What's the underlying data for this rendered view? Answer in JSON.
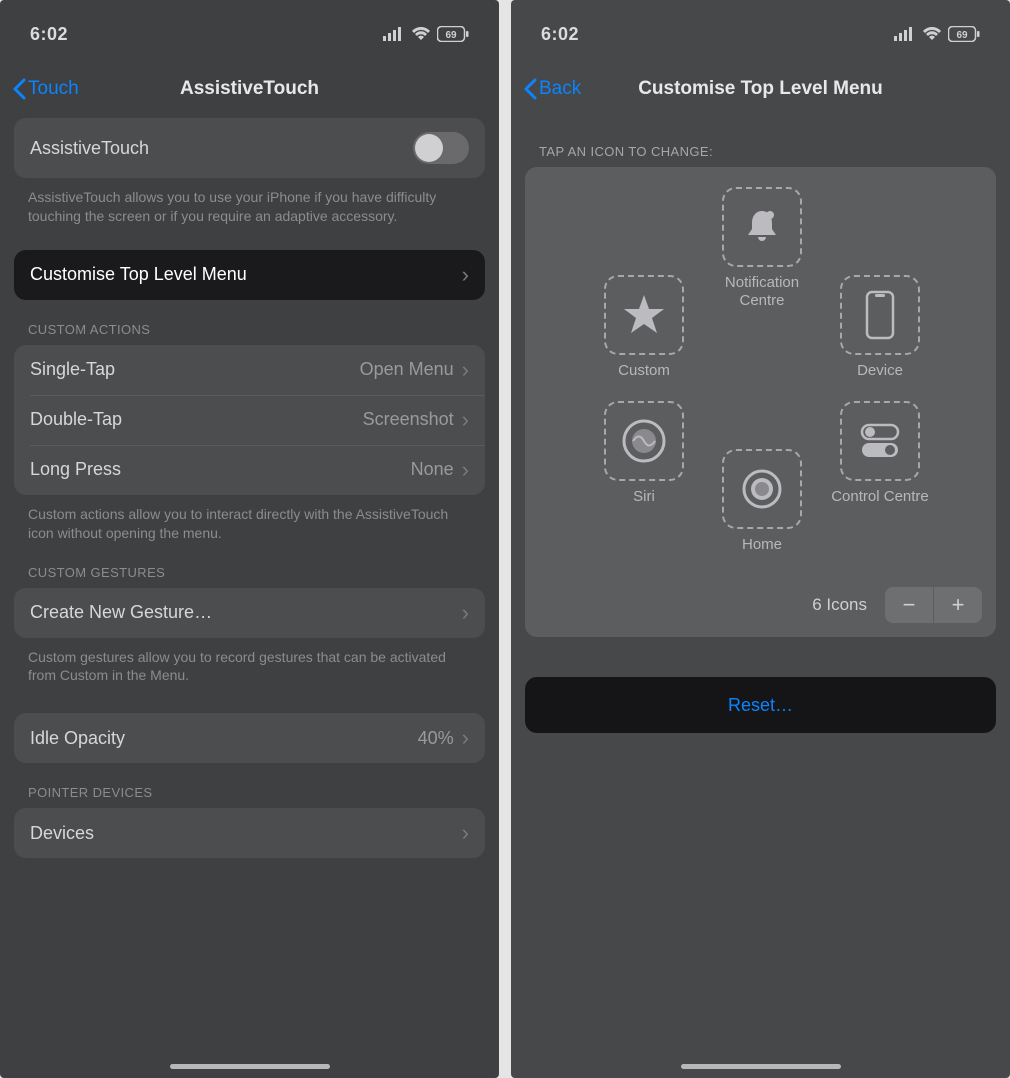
{
  "status": {
    "time": "6:02",
    "battery": "69"
  },
  "left": {
    "back": "Touch",
    "title": "AssistiveTouch",
    "toggle_label": "AssistiveTouch",
    "toggle_desc": "AssistiveTouch allows you to use your iPhone if you have difficulty touching the screen or if you require an adaptive accessory.",
    "customise": "Customise Top Level Menu",
    "custom_actions_header": "CUSTOM ACTIONS",
    "actions": {
      "single_tap": {
        "label": "Single-Tap",
        "value": "Open Menu"
      },
      "double_tap": {
        "label": "Double-Tap",
        "value": "Screenshot"
      },
      "long_press": {
        "label": "Long Press",
        "value": "None"
      }
    },
    "actions_desc": "Custom actions allow you to interact directly with the AssistiveTouch icon without opening the menu.",
    "gestures_header": "CUSTOM GESTURES",
    "create_gesture": "Create New Gesture…",
    "gestures_desc": "Custom gestures allow you to record gestures that can be activated from Custom in the Menu.",
    "idle_opacity": {
      "label": "Idle Opacity",
      "value": "40%"
    },
    "pointer_header": "POINTER DEVICES",
    "devices": "Devices"
  },
  "right": {
    "back": "Back",
    "title": "Customise Top Level Menu",
    "tap_prompt": "TAP AN ICON TO CHANGE:",
    "icons": {
      "notification": "Notification Centre",
      "custom": "Custom",
      "device": "Device",
      "siri": "Siri",
      "control": "Control Centre",
      "home": "Home"
    },
    "count": "6 Icons",
    "reset": "Reset…"
  }
}
